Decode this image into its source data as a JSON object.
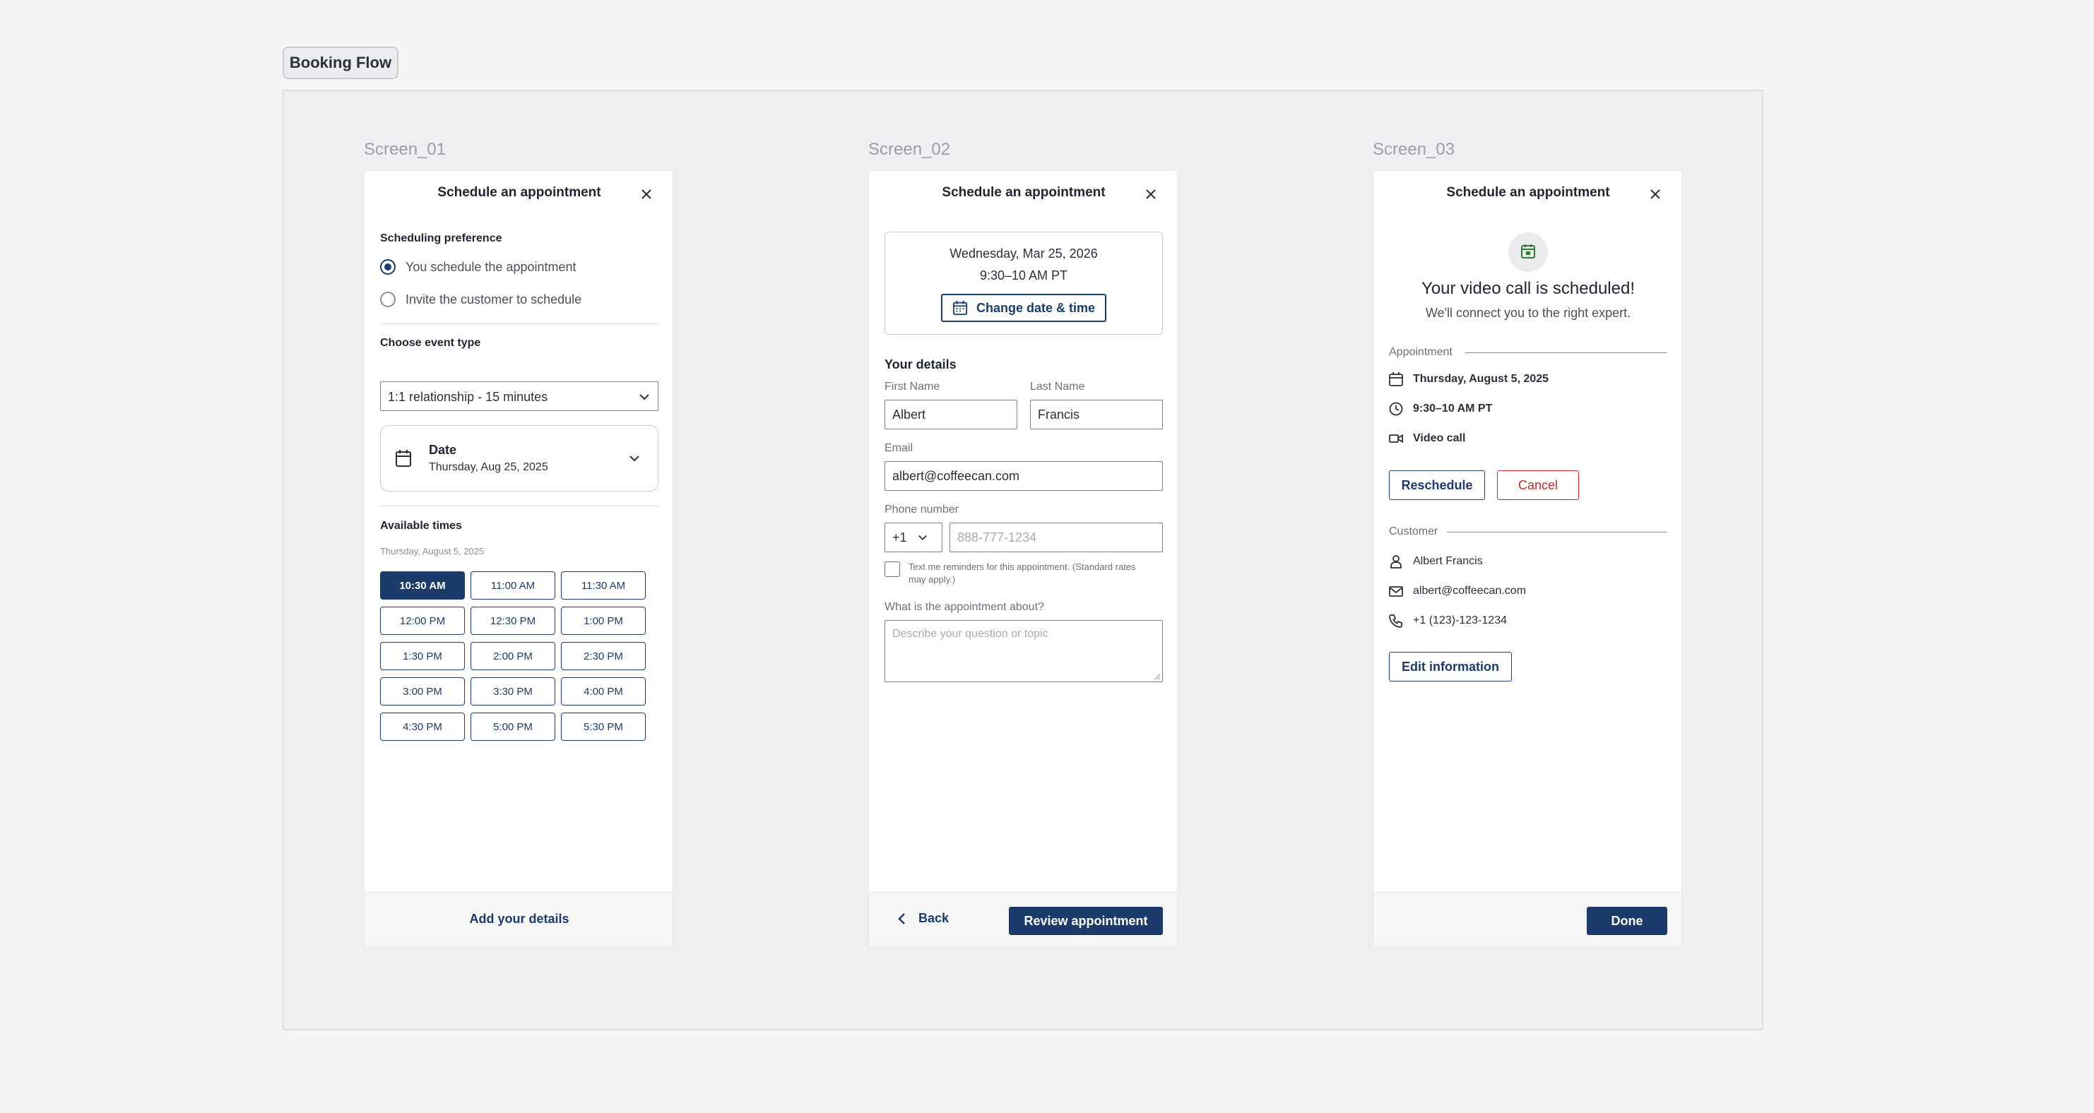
{
  "flow_title": "Booking Flow",
  "screen_labels": [
    "Screen_01",
    "Screen_02",
    "Screen_03"
  ],
  "modal_title": "Schedule an appointment",
  "screen1": {
    "scheduling_label": "Scheduling preference",
    "option_self": "You schedule the appointment",
    "option_invite": "Invite the customer to schedule",
    "event_label": "Choose event type",
    "event_value": "1:1 relationship - 15 minutes",
    "date_label": "Date",
    "date_value": "Thursday, Aug 25, 2025",
    "times_label": "Available times",
    "times_date": "Thursday, August 5, 2025",
    "slots": [
      "10:30 AM",
      "11:00 AM",
      "11:30 AM",
      "12:00 PM",
      "12:30 PM",
      "1:00 PM",
      "1:30 PM",
      "2:00 PM",
      "2:30 PM",
      "3:00 PM",
      "3:30 PM",
      "4:00 PM",
      "4:30 PM",
      "5:00 PM",
      "5:30 PM"
    ],
    "footer_action": "Add your details"
  },
  "screen2": {
    "summary_date": "Wednesday, Mar 25, 2026",
    "summary_time": "9:30–10 AM PT",
    "change_label": "Change date & time",
    "details_label": "Your details",
    "first_name_label": "First Name",
    "first_name": "Albert",
    "last_name_label": "Last Name",
    "last_name": "Francis",
    "email_label": "Email",
    "email": "albert@coffeecan.com",
    "phone_label": "Phone number",
    "country_code": "+1",
    "phone_placeholder": "888-777-1234",
    "sms_text_1": "Text me reminders for this appointment. (Standard rates",
    "sms_text_2": "may apply.)",
    "topic_label": "What is the appointment about?",
    "topic_placeholder": "Describe your question or topic",
    "back_label": "Back",
    "review_label": "Review appointment"
  },
  "screen3": {
    "headline": "Your video call is scheduled!",
    "subline": "We'll connect you to the right expert.",
    "appointment_label": "Appointment",
    "appt_date": "Thursday, August 5, 2025",
    "appt_time": "9:30–10 AM PT",
    "appt_type": "Video call",
    "reschedule_label": "Reschedule",
    "cancel_label": "Cancel",
    "customer_label": "Customer",
    "cust_name": "Albert Francis",
    "cust_email": "albert@coffeecan.com",
    "cust_phone": "+1 (123)-123-1234",
    "edit_label": "Edit information",
    "done_label": "Done"
  },
  "colors": {
    "primary": "#1b3c6b",
    "danger": "#c62828",
    "success": "#2e7d32"
  }
}
